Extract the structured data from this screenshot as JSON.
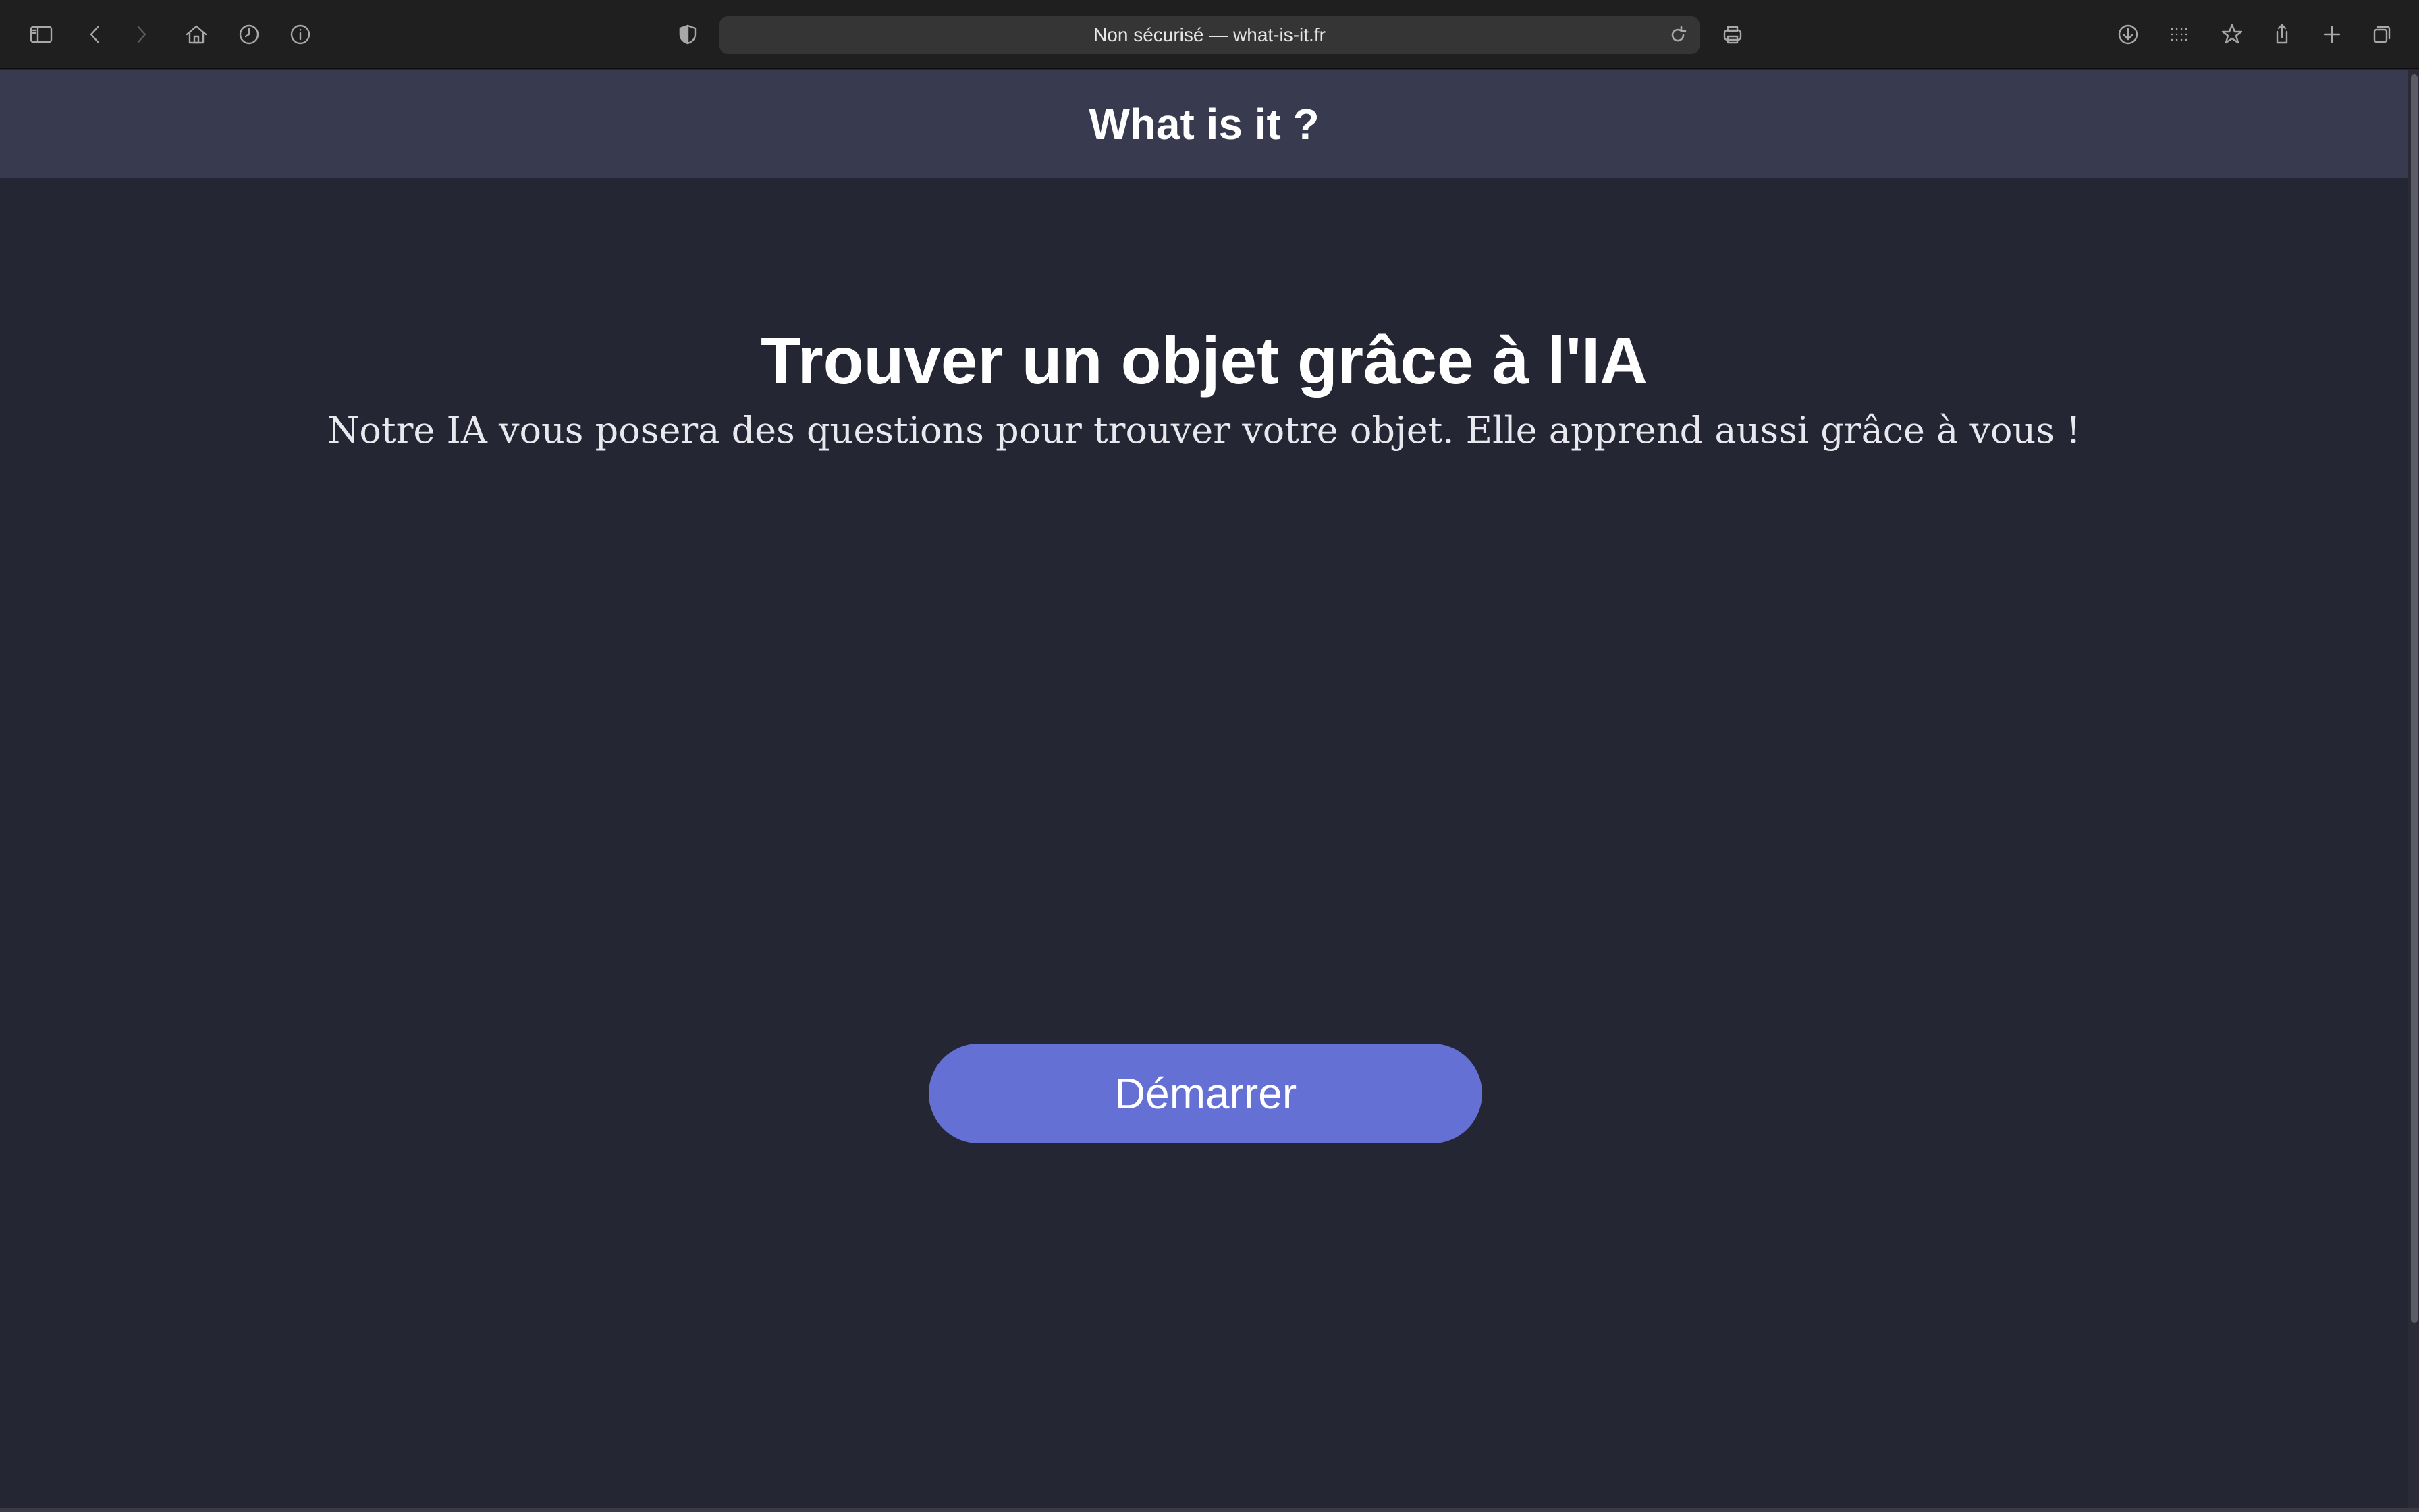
{
  "browser": {
    "address": "Non sécurisé — what-is-it.fr",
    "icons": {
      "sidebar": "sidebar-icon",
      "back": "chevron-left-icon",
      "forward": "chevron-right-icon",
      "home": "home-icon",
      "history": "clock-icon",
      "info": "info-icon",
      "privacy": "shield-icon",
      "reload": "reload-icon",
      "print": "printer-icon",
      "downloads": "download-icon",
      "grid": "grid-icon",
      "bookmark": "star-icon",
      "share": "share-icon",
      "new_tab": "plus-icon",
      "tabs": "tabs-overview-icon"
    }
  },
  "header": {
    "title": "What is it ?"
  },
  "hero": {
    "title": "Trouver un objet grâce à l'IA",
    "subtitle": "Notre IA vous posera des questions pour trouver votre objet. Elle apprend aussi grâce à vous !"
  },
  "actions": {
    "start_label": "Démarrer"
  },
  "colors": {
    "page_background": "#252633",
    "header_background": "#383b4f",
    "button_background": "#6570d4",
    "text": "#ffffff"
  }
}
